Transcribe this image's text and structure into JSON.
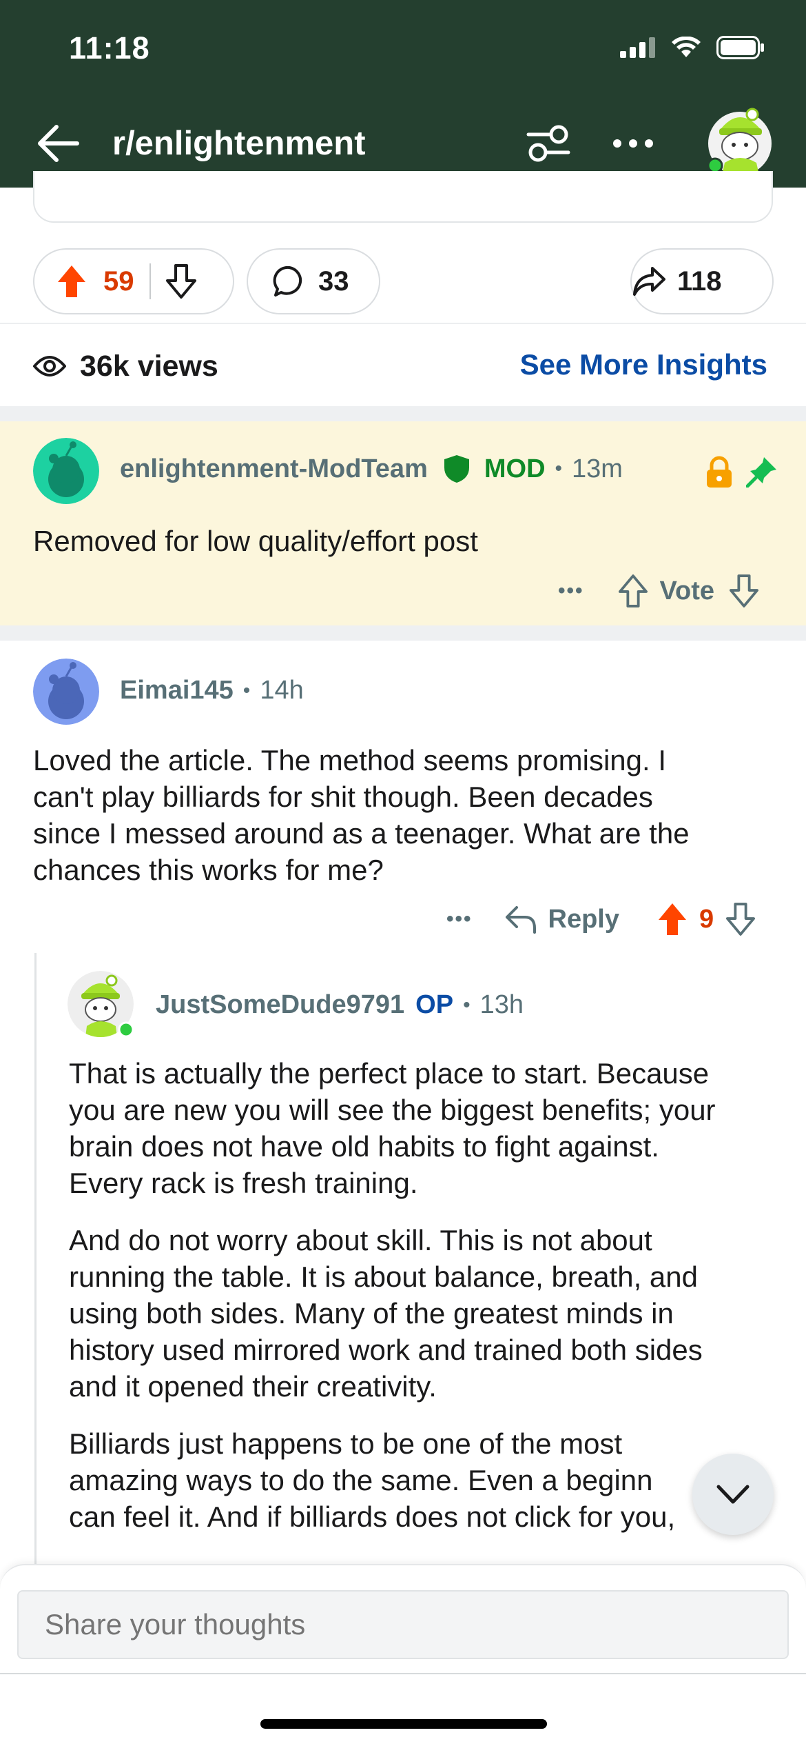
{
  "status_bar": {
    "time": "11:18"
  },
  "header": {
    "title": "r/enlightenment"
  },
  "post_actions": {
    "upvotes": "59",
    "comments": "33",
    "shares": "118"
  },
  "insights": {
    "views": "36k views",
    "link": "See More Insights"
  },
  "mod_comment": {
    "username": "enlightenment-ModTeam",
    "badge": "MOD",
    "time": "13m",
    "text": "Removed for low quality/effort post",
    "more": "•••",
    "vote_label": "Vote"
  },
  "comment1": {
    "username": "Eimai145",
    "time": "14h",
    "lines": [
      "Loved the article. The method seems promising. I",
      "can't play billiards for shit though. Been decades",
      "since I messed around as a teenager. What are the",
      "chances this works for me?"
    ],
    "more": "•••",
    "reply_label": "Reply",
    "score": "9"
  },
  "reply1": {
    "username": "JustSomeDude9791",
    "op_badge": "OP",
    "time": "13h",
    "para1": [
      "That is actually the perfect place to start. Because",
      "you are new you will see the biggest benefits; your",
      "brain does not have old habits to fight against.",
      "Every rack is fresh training."
    ],
    "para2": [
      "And do not worry about skill. This is not about",
      "running the table. It is about balance, breath, and",
      "using both sides. Many of the greatest minds in",
      "history used mirrored work and trained both sides",
      "and it opened their creativity."
    ],
    "para3": [
      "Billiards just happens to be one of the most",
      "amazing ways to do the same. Even a beginn",
      "can feel it. And if billiards does not click for you,"
    ]
  },
  "composer": {
    "placeholder": "Share your thoughts"
  },
  "colors": {
    "header_bg": "#243f2f",
    "upvote_orange": "#ff4500",
    "score_red": "#d93a00",
    "mod_green": "#0f8a28",
    "op_blue": "#0b4ca5",
    "mod_bg": "#fcf6dc"
  },
  "icons": [
    "back-arrow-icon",
    "filter-icon",
    "more-icon",
    "avatar-icon",
    "upvote-icon",
    "downvote-icon",
    "comment-icon",
    "share-icon",
    "eye-icon",
    "shield-icon",
    "lock-icon",
    "pin-icon",
    "reply-icon",
    "chevron-down-icon"
  ]
}
